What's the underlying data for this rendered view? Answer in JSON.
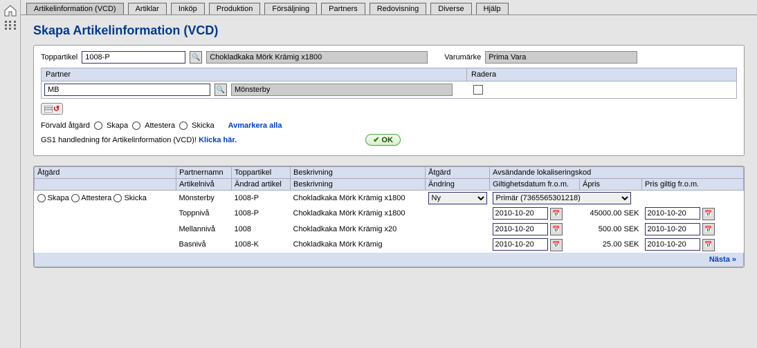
{
  "nav": {
    "tabs": [
      "Artikelinformation (VCD)",
      "Artiklar",
      "Inköp",
      "Produktion",
      "Försäljning",
      "Partners",
      "Redovisning",
      "Diverse",
      "Hjälp"
    ],
    "active_index": 0
  },
  "page": {
    "title": "Skapa Artikelinformation (VCD)"
  },
  "topitem": {
    "label": "Toppartikel",
    "code": "1008-P",
    "description": "Chokladkaka Mörk Krämig x1800",
    "brand_label": "Varumärke",
    "brand_value": "Prima Vara"
  },
  "partner": {
    "header_partner": "Partner",
    "header_delete": "Radera",
    "code": "MB",
    "name": "Mönsterby"
  },
  "actions": {
    "label": "Förvald åtgärd",
    "skapa": "Skapa",
    "attestera": "Attestera",
    "skicka": "Skicka",
    "unselect": "Avmarkera alla",
    "ok": "OK"
  },
  "help": {
    "text": "GS1 handledning för Artikelinformation (VCD)!",
    "link": "Klicka här."
  },
  "grid": {
    "headers": {
      "action": "Åtgärd",
      "partner_name": "Partnernamn",
      "top_article": "Toppartikel",
      "description": "Beskrivning",
      "action2": "Åtgärd",
      "sender_code": "Avsändande lokaliseringskod",
      "article_level": "Artikelnivå",
      "changed_article": "Ändrad artikel",
      "description2": "Beskrivning",
      "change": "Ändring",
      "valid_from": "Giltighetsdatum fr.o.m.",
      "price": "Ápris",
      "price_valid_from": "Pris giltig fr.o.m."
    },
    "row_actions": {
      "skapa": "Skapa",
      "attestera": "Attestera",
      "skicka": "Skicka"
    },
    "action_select": {
      "value": "Ny"
    },
    "sender_select": {
      "value": "Primär (7365565301218)"
    },
    "rows": [
      {
        "level": "Mönsterby",
        "article": "1008-P",
        "desc": "Chokladkaka Mörk Krämig x1800",
        "date": "",
        "price": "",
        "pdate": ""
      },
      {
        "level": "Toppnivå",
        "article": "1008-P",
        "desc": "Chokladkaka Mörk Krämig x1800",
        "date": "2010-10-20",
        "price": "45000.00 SEK",
        "pdate": "2010-10-20"
      },
      {
        "level": "Mellannivå",
        "article": "1008",
        "desc": "Chokladkaka Mörk Krämig x20",
        "date": "2010-10-20",
        "price": "500.00 SEK",
        "pdate": "2010-10-20"
      },
      {
        "level": "Basnivå",
        "article": "1008-K",
        "desc": "Chokladkaka Mörk Krämig",
        "date": "2010-10-20",
        "price": "25.00 SEK",
        "pdate": "2010-10-20"
      }
    ]
  },
  "footer": {
    "next": "Nästa »"
  }
}
